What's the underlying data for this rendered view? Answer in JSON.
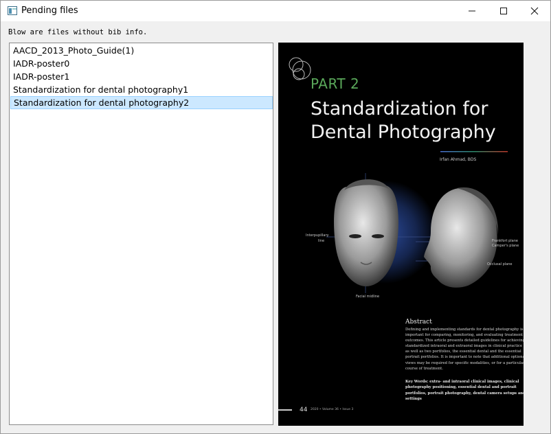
{
  "window": {
    "title": "Pending files"
  },
  "caption": "Blow are files without bib info.",
  "files": [
    "AACD_2013_Photo_Guide(1)",
    "IADR-poster0",
    "IADR-poster1",
    "Standardization for dental photography1",
    "Standardization for dental photography2"
  ],
  "selected_index": 4,
  "preview": {
    "part": "PART 2",
    "title_line1": "Standardization for",
    "title_line2": "Dental Photography",
    "author": "Irfan Ahmad, BDS",
    "labels": {
      "interpupillary": "Interpupillary",
      "line": "line",
      "frankfort": "Frankfort plane",
      "campers": "Camper's plane",
      "occlusal": "Occlusal plane",
      "facial_midline": "Facial midline"
    },
    "abstract_heading": "Abstract",
    "abstract_lines": [
      "Defining and implementing standards for dental photography is",
      "important for comparing, monitoring, and evaluating treatment",
      "outcomes. This article presents detailed guidelines for achieving",
      "standardized intraoral and extraoral images in clinical practice",
      "as well as two portfolios, the essential dental and the essential",
      "portrait portfolios. It is important to note that additional optional",
      "views may be required for specific modalities, or for a particular",
      "course of treatment."
    ],
    "keywords_lines": [
      "Key Words: extra- and intraoral clinical images, clinical",
      "photography positioning, essential dental and portrait",
      "portfolios, portrait photography, dental camera setups and",
      "settings"
    ],
    "page_number": "44",
    "issue": "2020 • Volume 36 • Issue 3",
    "colors": {
      "part": "#5aa85a",
      "rule_left": "#4a6fd0",
      "rule_right": "#c0392b"
    }
  }
}
